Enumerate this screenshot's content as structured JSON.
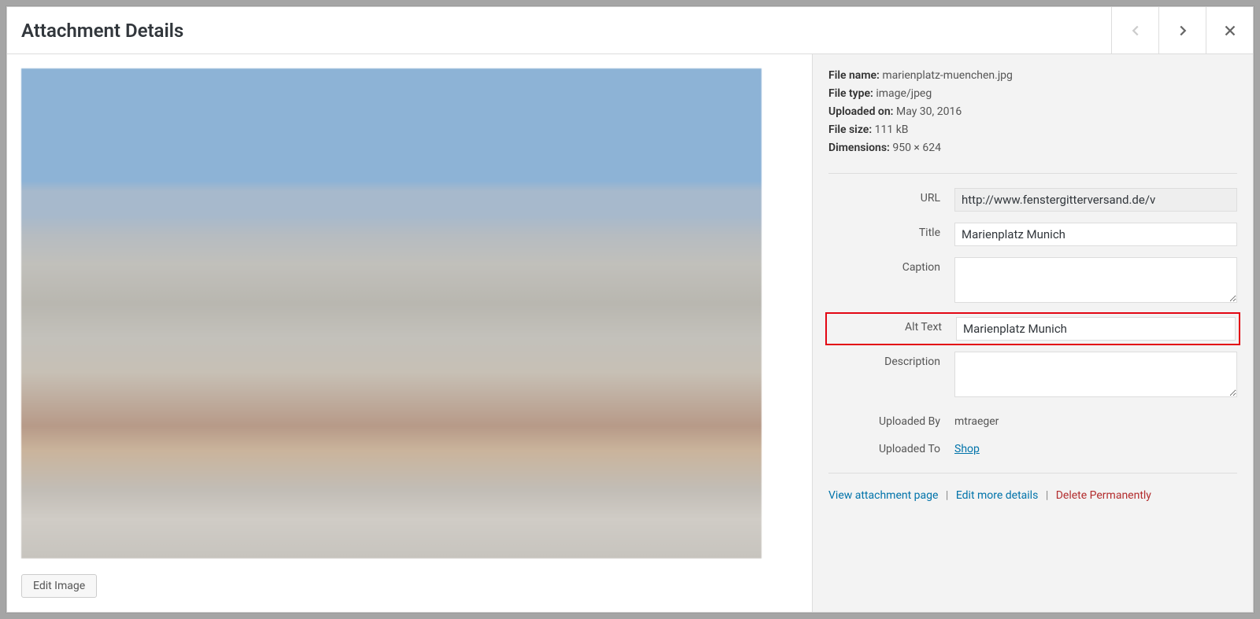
{
  "header": {
    "title": "Attachment Details"
  },
  "meta": {
    "file_name_label": "File name:",
    "file_name": "marienplatz-muenchen.jpg",
    "file_type_label": "File type:",
    "file_type": "image/jpeg",
    "uploaded_on_label": "Uploaded on:",
    "uploaded_on": "May 30, 2016",
    "file_size_label": "File size:",
    "file_size": "111 kB",
    "dimensions_label": "Dimensions:",
    "dimensions": "950 × 624"
  },
  "fields": {
    "url_label": "URL",
    "url_value": "http://www.fenstergitterversand.de/v",
    "title_label": "Title",
    "title_value": "Marienplatz Munich",
    "caption_label": "Caption",
    "caption_value": "",
    "alt_label": "Alt Text",
    "alt_value": "Marienplatz Munich",
    "description_label": "Description",
    "description_value": "",
    "uploaded_by_label": "Uploaded By",
    "uploaded_by_value": "mtraeger",
    "uploaded_to_label": "Uploaded To",
    "uploaded_to_value": "Shop"
  },
  "buttons": {
    "edit_image": "Edit Image",
    "view_page": "View attachment page",
    "edit_more": "Edit more details",
    "delete": "Delete Permanently"
  }
}
